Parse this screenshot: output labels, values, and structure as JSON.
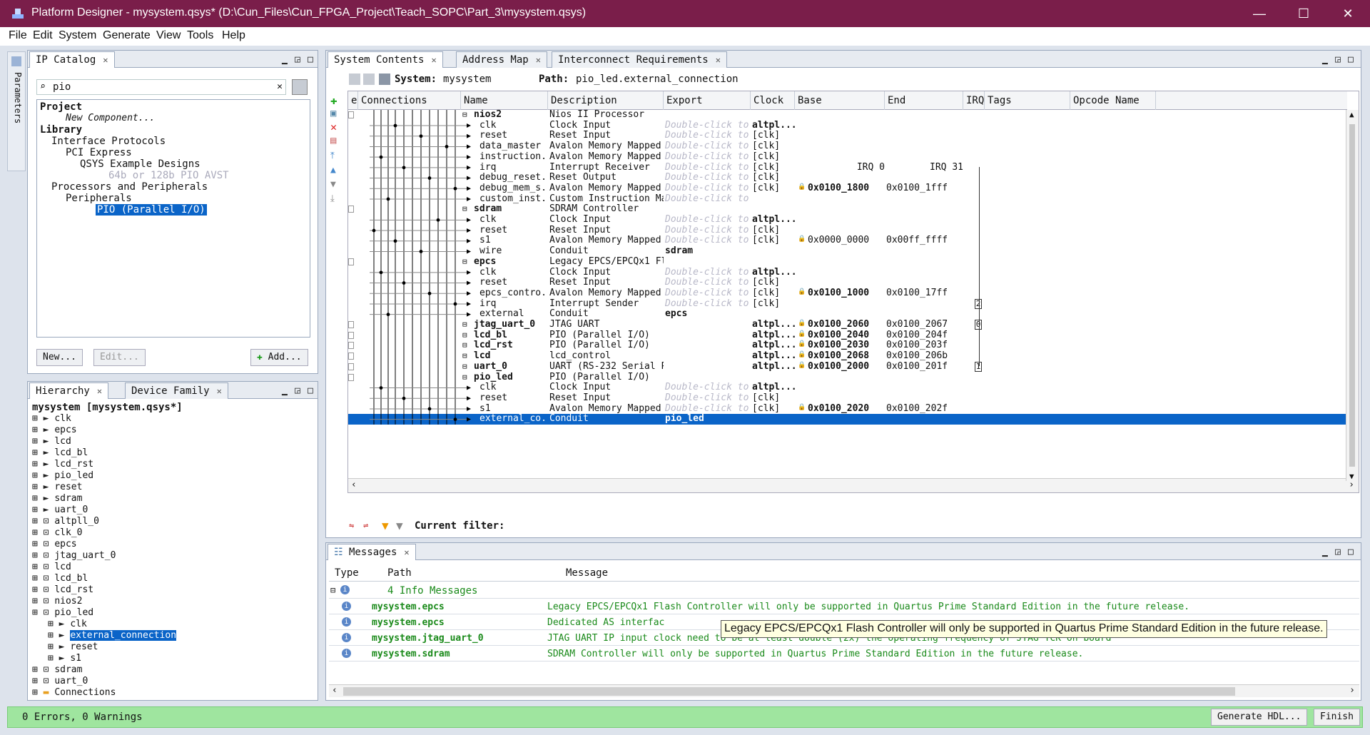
{
  "title": "Platform Designer - mysystem.qsys* (D:\\Cun_Files\\Cun_FPGA_Project\\Teach_SOPC\\Part_3\\mysystem.qsys)",
  "window_buttons": {
    "minimize": "—",
    "maximize": "☐",
    "close": "✕"
  },
  "menu": [
    "File",
    "Edit",
    "System",
    "Generate",
    "View",
    "Tools",
    "Help"
  ],
  "side_tab": "Parameters",
  "ip_catalog": {
    "tab": "IP Catalog",
    "search_value": "pio",
    "tree": [
      {
        "label": "Project",
        "bold": true
      },
      {
        "label": "New Component...",
        "italic": true
      },
      {
        "label": "Library",
        "bold": true
      },
      {
        "label": "Interface Protocols"
      },
      {
        "label": "PCI Express"
      },
      {
        "label": "QSYS Example Designs"
      },
      {
        "label": "64b or 128b PIO AVST",
        "dim": true
      },
      {
        "label": "Processors and Peripherals"
      },
      {
        "label": "Peripherals"
      },
      {
        "label": "PIO (Parallel I/O)",
        "selected": true
      }
    ],
    "buttons": {
      "new": "New...",
      "edit": "Edit...",
      "add": "Add..."
    }
  },
  "hierarchy": {
    "tabs": [
      "Hierarchy",
      "Device Family"
    ],
    "root": "mysystem [mysystem.qsys*]",
    "items": [
      "clk",
      "epcs",
      "lcd",
      "lcd_bl",
      "lcd_rst",
      "pio_led",
      "reset",
      "sdram",
      "uart_0",
      "altpll_0",
      "clk_0",
      "epcs",
      "jtag_uart_0",
      "lcd",
      "lcd_bl",
      "lcd_rst",
      "nios2",
      "pio_led",
      "clk",
      "external_connection",
      "reset",
      "s1",
      "sdram",
      "uart_0",
      "Connections"
    ]
  },
  "system_contents": {
    "tabs": [
      "System Contents",
      "Address Map",
      "Interconnect Requirements"
    ],
    "system_label": "System:",
    "system_name": "mysystem",
    "path_label": "Path:",
    "path_value": "pio_led.external_connection",
    "columns": [
      "e",
      "Connections",
      "Name",
      "Description",
      "Export",
      "Clock",
      "Base",
      "End",
      "IRQ",
      "Tags",
      "Opcode Name"
    ],
    "rows": [
      {
        "name": "nios2",
        "desc": "Nios II Processor",
        "export": "",
        "clock": "",
        "base": "",
        "end": "",
        "module": true
      },
      {
        "name": "clk",
        "desc": "Clock Input",
        "export": "Double-click to",
        "clock": "altpl...",
        "base": "",
        "end": ""
      },
      {
        "name": "reset",
        "desc": "Reset Input",
        "export": "Double-click to",
        "clock": "[clk]",
        "base": "",
        "end": ""
      },
      {
        "name": "data_master",
        "desc": "Avalon Memory Mapped ...",
        "export": "Double-click to",
        "clock": "[clk]",
        "base": "",
        "end": ""
      },
      {
        "name": "instruction...",
        "desc": "Avalon Memory Mapped ...",
        "export": "Double-click to",
        "clock": "[clk]",
        "base": "",
        "end": ""
      },
      {
        "name": "irq",
        "desc": "Interrupt Receiver",
        "export": "Double-click to",
        "clock": "[clk]",
        "base": "IRQ 0",
        "end": "IRQ 31"
      },
      {
        "name": "debug_reset...",
        "desc": "Reset Output",
        "export": "Double-click to",
        "clock": "[clk]",
        "base": "",
        "end": ""
      },
      {
        "name": "debug_mem_s...",
        "desc": "Avalon Memory Mapped ...",
        "export": "Double-click to",
        "clock": "[clk]",
        "base": "0x0100_1800",
        "end": "0x0100_1fff"
      },
      {
        "name": "custom_inst...",
        "desc": "Custom Instruction Ma...",
        "export": "Double-click to",
        "clock": "",
        "base": "",
        "end": ""
      },
      {
        "name": "sdram",
        "desc": "SDRAM Controller",
        "export": "",
        "clock": "",
        "base": "",
        "end": "",
        "module": true
      },
      {
        "name": "clk",
        "desc": "Clock Input",
        "export": "Double-click to",
        "clock": "altpl...",
        "base": "",
        "end": ""
      },
      {
        "name": "reset",
        "desc": "Reset Input",
        "export": "Double-click to",
        "clock": "[clk]",
        "base": "",
        "end": ""
      },
      {
        "name": "s1",
        "desc": "Avalon Memory Mapped ...",
        "export": "Double-click to",
        "clock": "[clk]",
        "base": "0x0000_0000",
        "end": "0x00ff_ffff"
      },
      {
        "name": "wire",
        "desc": "Conduit",
        "export": "sdram",
        "clock": "",
        "base": "",
        "end": ""
      },
      {
        "name": "epcs",
        "desc": "Legacy EPCS/EPCQx1 Fl...",
        "export": "",
        "clock": "",
        "base": "",
        "end": "",
        "module": true
      },
      {
        "name": "clk",
        "desc": "Clock Input",
        "export": "Double-click to",
        "clock": "altpl...",
        "base": "",
        "end": ""
      },
      {
        "name": "reset",
        "desc": "Reset Input",
        "export": "Double-click to",
        "clock": "[clk]",
        "base": "",
        "end": ""
      },
      {
        "name": "epcs_contro...",
        "desc": "Avalon Memory Mapped ...",
        "export": "Double-click to",
        "clock": "[clk]",
        "base": "0x0100_1000",
        "end": "0x0100_17ff"
      },
      {
        "name": "irq",
        "desc": "Interrupt Sender",
        "export": "Double-click to",
        "clock": "[clk]",
        "base": "",
        "end": ""
      },
      {
        "name": "external",
        "desc": "Conduit",
        "export": "epcs",
        "clock": "",
        "base": "",
        "end": ""
      },
      {
        "name": "jtag_uart_0",
        "desc": "JTAG UART",
        "export": "",
        "clock": "altpl...",
        "base": "0x0100_2060",
        "end": "0x0100_2067",
        "module": true
      },
      {
        "name": "lcd_bl",
        "desc": "PIO (Parallel I/O)",
        "export": "",
        "clock": "altpl...",
        "base": "0x0100_2040",
        "end": "0x0100_204f",
        "module": true
      },
      {
        "name": "lcd_rst",
        "desc": "PIO (Parallel I/O)",
        "export": "",
        "clock": "altpl...",
        "base": "0x0100_2030",
        "end": "0x0100_203f",
        "module": true
      },
      {
        "name": "lcd",
        "desc": "lcd_control",
        "export": "",
        "clock": "altpl...",
        "base": "0x0100_2068",
        "end": "0x0100_206b",
        "module": true
      },
      {
        "name": "uart_0",
        "desc": "UART (RS-232 Serial P...",
        "export": "",
        "clock": "altpl...",
        "base": "0x0100_2000",
        "end": "0x0100_201f",
        "module": true
      },
      {
        "name": "pio_led",
        "desc": "PIO (Parallel I/O)",
        "export": "",
        "clock": "",
        "base": "",
        "end": "",
        "module": true
      },
      {
        "name": "clk",
        "desc": "Clock Input",
        "export": "Double-click to",
        "clock": "altpl...",
        "base": "",
        "end": ""
      },
      {
        "name": "reset",
        "desc": "Reset Input",
        "export": "Double-click to",
        "clock": "[clk]",
        "base": "",
        "end": ""
      },
      {
        "name": "s1",
        "desc": "Avalon Memory Mapped ...",
        "export": "Double-click to",
        "clock": "[clk]",
        "base": "0x0100_2020",
        "end": "0x0100_202f"
      },
      {
        "name": "external_co...",
        "desc": "Conduit",
        "export": "pio_led",
        "clock": "",
        "base": "",
        "end": "",
        "selected": true
      }
    ],
    "irq_numbers": [
      "2",
      "0",
      "1"
    ],
    "filter_label": "Current filter:"
  },
  "messages": {
    "tab": "Messages",
    "columns": [
      "Type",
      "Path",
      "Message"
    ],
    "summary": "4 Info Messages",
    "rows": [
      {
        "path": "mysystem.epcs",
        "message": "Legacy EPCS/EPCQx1 Flash Controller will only be supported in Quartus Prime Standard Edition in the future release."
      },
      {
        "path": "mysystem.epcs",
        "message": "Dedicated AS interfac"
      },
      {
        "path": "mysystem.jtag_uart_0",
        "message": "JTAG UART IP input clock need to be at least double (2x) the operating frequency of JTAG TCK on board"
      },
      {
        "path": "mysystem.sdram",
        "message": "SDRAM Controller will only be supported in Quartus Prime Standard Edition in the future release."
      }
    ],
    "tooltip": "Legacy EPCS/EPCQx1 Flash Controller will only be supported in Quartus Prime Standard Edition in the future release."
  },
  "status": {
    "text": "0 Errors, 0 Warnings",
    "generate": "Generate HDL...",
    "finish": "Finish"
  }
}
